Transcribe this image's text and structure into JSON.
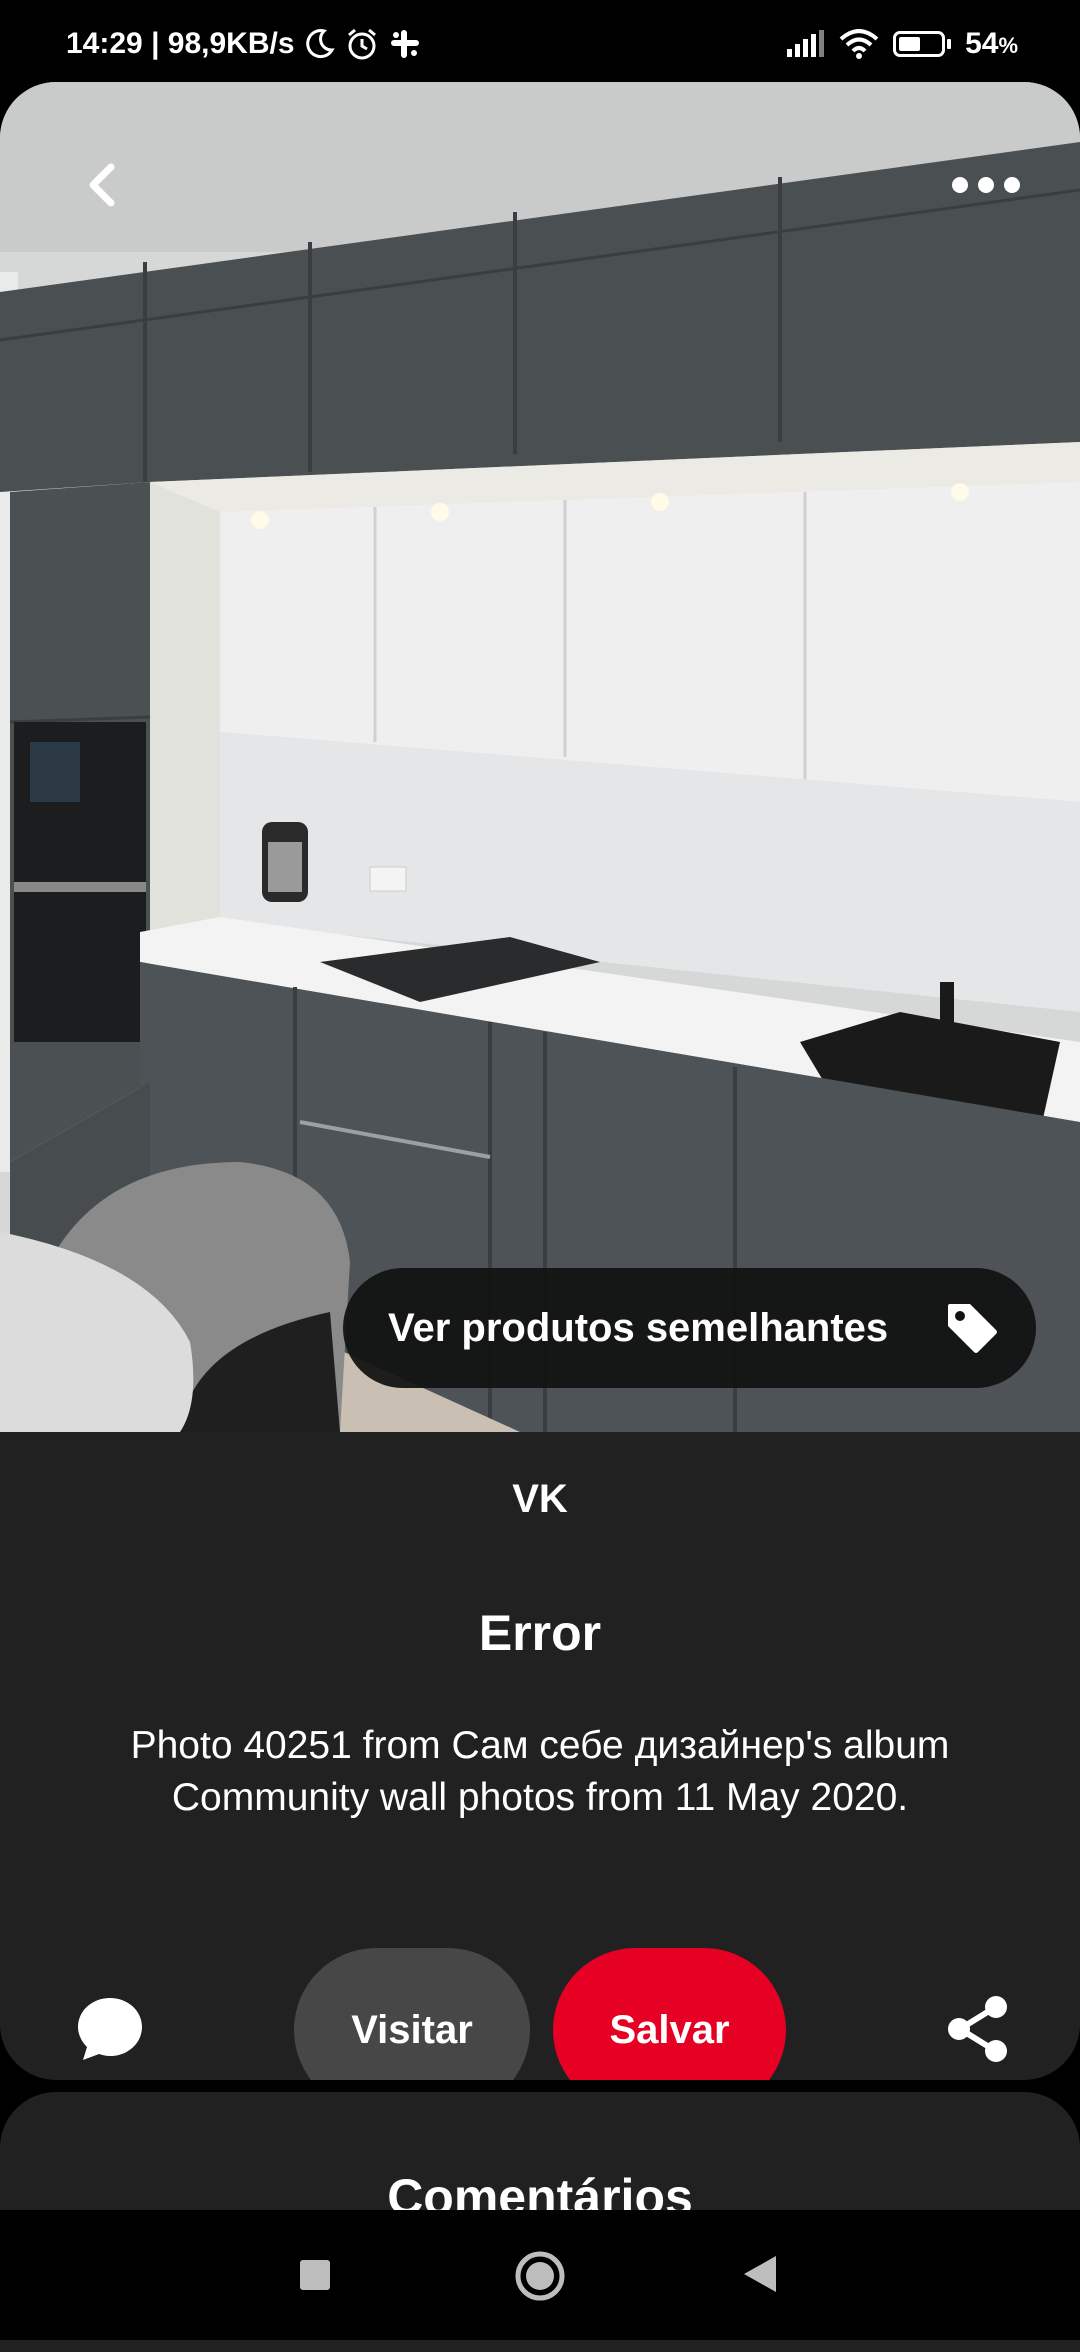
{
  "status_bar": {
    "time_speed": "14:29 | 98,9KB/s",
    "battery": "54",
    "battery_unit": "%",
    "battery_level": 0.54
  },
  "pin": {
    "similar_products_label": "Ver produtos semelhantes",
    "source_name": "VK",
    "title": "Error",
    "description": "Photo 40251 from Сам себе дизайнер's album Community wall photos from 11 May 2020.",
    "visit_label": "Visitar",
    "save_label": "Salvar"
  },
  "comments": {
    "title": "Comentários"
  },
  "colors": {
    "save_accent": "#e60023",
    "card_background": "#212121"
  },
  "icons": {
    "back": "chevron-left-icon",
    "more": "more-horizontal-icon",
    "tag": "tag-icon",
    "comment": "speech-bubble-icon",
    "share": "share-icon"
  }
}
